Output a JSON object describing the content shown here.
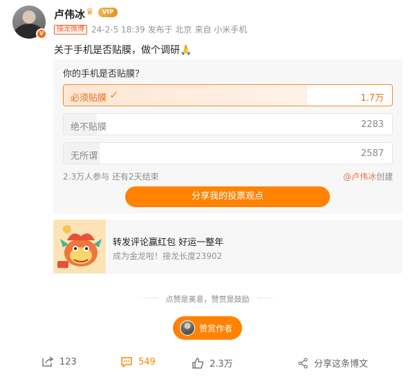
{
  "user": {
    "name": "卢伟冰",
    "vip_label": "VIP"
  },
  "meta": {
    "tag": "接龙微博",
    "timestamp": "24-2-5 18:39",
    "location": "发布于 北京",
    "source": "来自 小米手机"
  },
  "post": {
    "text": "关于手机是否贴膜，做个调研"
  },
  "poll": {
    "question": "你的手机是否贴膜？",
    "options": [
      {
        "label": "必须贴膜",
        "count": "1.7万",
        "share": 0.74,
        "selected": true
      },
      {
        "label": "绝不贴膜",
        "count": "2283",
        "share": 0.1,
        "selected": false
      },
      {
        "label": "无所谓",
        "count": "2587",
        "share": 0.11,
        "selected": false
      }
    ],
    "participants": "2.3万人参与 还有2天结束",
    "creator_at": "@卢伟冰",
    "creator_suffix": "创建",
    "share_button": "分享我的投票观点"
  },
  "promo": {
    "title": "转发评论赢红包 好运一整年",
    "subtitle": "成为金龙啦！接龙长度23902"
  },
  "reward": {
    "divider_text": "点赞是美意，赞赏是鼓励",
    "button_label": "赞赏作者"
  },
  "footer": {
    "forward_count": "123",
    "comment_count": "549",
    "like_count": "2.3万",
    "share_label": "分享这条博文"
  },
  "colors": {
    "accent": "#ff8200",
    "link": "#eb7350"
  },
  "icons": [
    "crown-icon",
    "check-icon",
    "dragon-illustration",
    "forward-icon",
    "comment-icon",
    "like-icon",
    "share-icon"
  ]
}
